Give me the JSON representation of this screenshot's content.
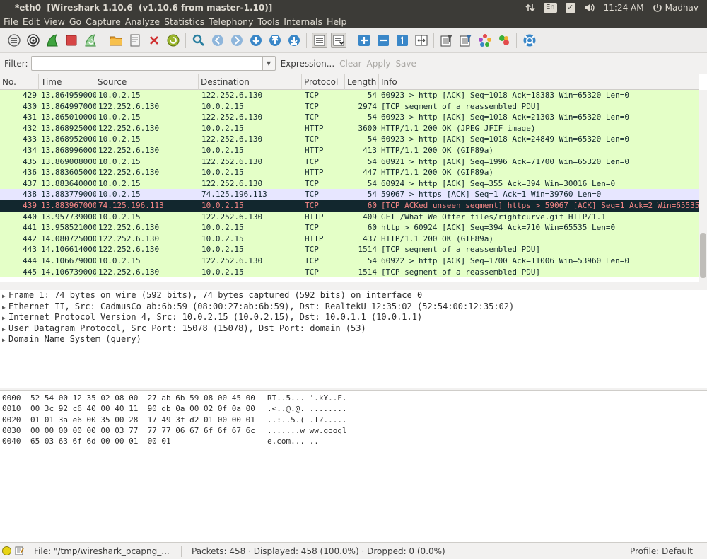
{
  "window": {
    "title": "*eth0  [Wireshark 1.10.6  (v1.10.6 from master-1.10)]",
    "tray": {
      "keyboard": "En",
      "time": "11:24 AM",
      "user": "Madhav"
    }
  },
  "menu": [
    "File",
    "Edit",
    "View",
    "Go",
    "Capture",
    "Analyze",
    "Statistics",
    "Telephony",
    "Tools",
    "Internals",
    "Help"
  ],
  "filter": {
    "label": "Filter:",
    "value": "",
    "expression_label": "Expression...",
    "clear_label": "Clear",
    "apply_label": "Apply",
    "save_label": "Save"
  },
  "packet_list": {
    "columns": [
      "No.",
      "Time",
      "Source",
      "Destination",
      "Protocol",
      "Length",
      "Info"
    ],
    "rows": [
      {
        "no": "429",
        "time": "13.864959000",
        "src": "10.0.2.15",
        "dst": "122.252.6.130",
        "proto": "TCP",
        "len": "54",
        "info": "60923 > http [ACK] Seq=1018 Ack=18383 Win=65320 Len=0",
        "style": "tcp"
      },
      {
        "no": "430",
        "time": "13.864997000",
        "src": "122.252.6.130",
        "dst": "10.0.2.15",
        "proto": "TCP",
        "len": "2974",
        "info": "[TCP segment of a reassembled PDU]",
        "style": "tcp"
      },
      {
        "no": "431",
        "time": "13.865010000",
        "src": "10.0.2.15",
        "dst": "122.252.6.130",
        "proto": "TCP",
        "len": "54",
        "info": "60923 > http [ACK] Seq=1018 Ack=21303 Win=65320 Len=0",
        "style": "tcp"
      },
      {
        "no": "432",
        "time": "13.868925000",
        "src": "122.252.6.130",
        "dst": "10.0.2.15",
        "proto": "HTTP",
        "len": "3600",
        "info": "HTTP/1.1 200 OK  (JPEG JFIF image)",
        "style": "tcp"
      },
      {
        "no": "433",
        "time": "13.868952000",
        "src": "10.0.2.15",
        "dst": "122.252.6.130",
        "proto": "TCP",
        "len": "54",
        "info": "60923 > http [ACK] Seq=1018 Ack=24849 Win=65320 Len=0",
        "style": "tcp"
      },
      {
        "no": "434",
        "time": "13.868996000",
        "src": "122.252.6.130",
        "dst": "10.0.2.15",
        "proto": "HTTP",
        "len": "413",
        "info": "HTTP/1.1 200 OK  (GIF89a)",
        "style": "tcp"
      },
      {
        "no": "435",
        "time": "13.869008000",
        "src": "10.0.2.15",
        "dst": "122.252.6.130",
        "proto": "TCP",
        "len": "54",
        "info": "60921 > http [ACK] Seq=1996 Ack=71700 Win=65320 Len=0",
        "style": "tcp"
      },
      {
        "no": "436",
        "time": "13.883605000",
        "src": "122.252.6.130",
        "dst": "10.0.2.15",
        "proto": "HTTP",
        "len": "447",
        "info": "HTTP/1.1 200 OK  (GIF89a)",
        "style": "tcp"
      },
      {
        "no": "437",
        "time": "13.883640000",
        "src": "10.0.2.15",
        "dst": "122.252.6.130",
        "proto": "TCP",
        "len": "54",
        "info": "60924 > http [ACK] Seq=355 Ack=394 Win=30016 Len=0",
        "style": "tcp"
      },
      {
        "no": "438",
        "time": "13.883779000",
        "src": "10.0.2.15",
        "dst": "74.125.196.113",
        "proto": "TCP",
        "len": "54",
        "info": "59067 > https [ACK] Seq=1 Ack=1 Win=39760 Len=0",
        "style": "udp"
      },
      {
        "no": "439",
        "time": "13.883967000",
        "src": "74.125.196.113",
        "dst": "10.0.2.15",
        "proto": "TCP",
        "len": "60",
        "info": "[TCP ACKed unseen segment] https > 59067 [ACK] Seq=1 Ack=2 Win=65535",
        "style": "bad"
      },
      {
        "no": "440",
        "time": "13.957739000",
        "src": "10.0.2.15",
        "dst": "122.252.6.130",
        "proto": "HTTP",
        "len": "409",
        "info": "GET /What_We_Offer_files/rightcurve.gif HTTP/1.1",
        "style": "tcp"
      },
      {
        "no": "441",
        "time": "13.958521000",
        "src": "122.252.6.130",
        "dst": "10.0.2.15",
        "proto": "TCP",
        "len": "60",
        "info": "http > 60924 [ACK] Seq=394 Ack=710 Win=65535 Len=0",
        "style": "tcp"
      },
      {
        "no": "442",
        "time": "14.080725000",
        "src": "122.252.6.130",
        "dst": "10.0.2.15",
        "proto": "HTTP",
        "len": "437",
        "info": "HTTP/1.1 200 OK  (GIF89a)",
        "style": "tcp"
      },
      {
        "no": "443",
        "time": "14.106614000",
        "src": "122.252.6.130",
        "dst": "10.0.2.15",
        "proto": "TCP",
        "len": "1514",
        "info": "[TCP segment of a reassembled PDU]",
        "style": "tcp"
      },
      {
        "no": "444",
        "time": "14.106679000",
        "src": "10.0.2.15",
        "dst": "122.252.6.130",
        "proto": "TCP",
        "len": "54",
        "info": "60922 > http [ACK] Seq=1700 Ack=11006 Win=53960 Len=0",
        "style": "tcp"
      },
      {
        "no": "445",
        "time": "14.106739000",
        "src": "122.252.6.130",
        "dst": "10.0.2.15",
        "proto": "TCP",
        "len": "1514",
        "info": "[TCP segment of a reassembled PDU]",
        "style": "tcp"
      }
    ]
  },
  "details": [
    "Frame 1: 74 bytes on wire (592 bits), 74 bytes captured (592 bits) on interface 0",
    "Ethernet II, Src: CadmusCo_ab:6b:59 (08:00:27:ab:6b:59), Dst: RealtekU_12:35:02 (52:54:00:12:35:02)",
    "Internet Protocol Version 4, Src: 10.0.2.15 (10.0.2.15), Dst: 10.0.1.1 (10.0.1.1)",
    "User Datagram Protocol, Src Port: 15078 (15078), Dst Port: domain (53)",
    "Domain Name System (query)"
  ],
  "bytes": [
    {
      "off": "0000",
      "hex": "52 54 00 12 35 02 08 00  27 ab 6b 59 08 00 45 00",
      "ascii": "RT..5... '.kY..E."
    },
    {
      "off": "0010",
      "hex": "00 3c 92 c6 40 00 40 11  90 db 0a 00 02 0f 0a 00",
      "ascii": ".<..@.@. ........"
    },
    {
      "off": "0020",
      "hex": "01 01 3a e6 00 35 00 28  17 49 3f d2 01 00 00 01",
      "ascii": "..:..5.( .I?....."
    },
    {
      "off": "0030",
      "hex": "00 00 00 00 00 00 03 77  77 77 06 67 6f 6f 67 6c",
      "ascii": ".......w ww.googl"
    },
    {
      "off": "0040",
      "hex": "65 03 63 6f 6d 00 00 01  00 01",
      "ascii": "e.com... .."
    }
  ],
  "status": {
    "file": "File: \"/tmp/wireshark_pcapng_...",
    "packets": "Packets: 458 · Displayed: 458 (100.0%) · Dropped: 0 (0.0%)",
    "profile": "Profile: Default"
  }
}
